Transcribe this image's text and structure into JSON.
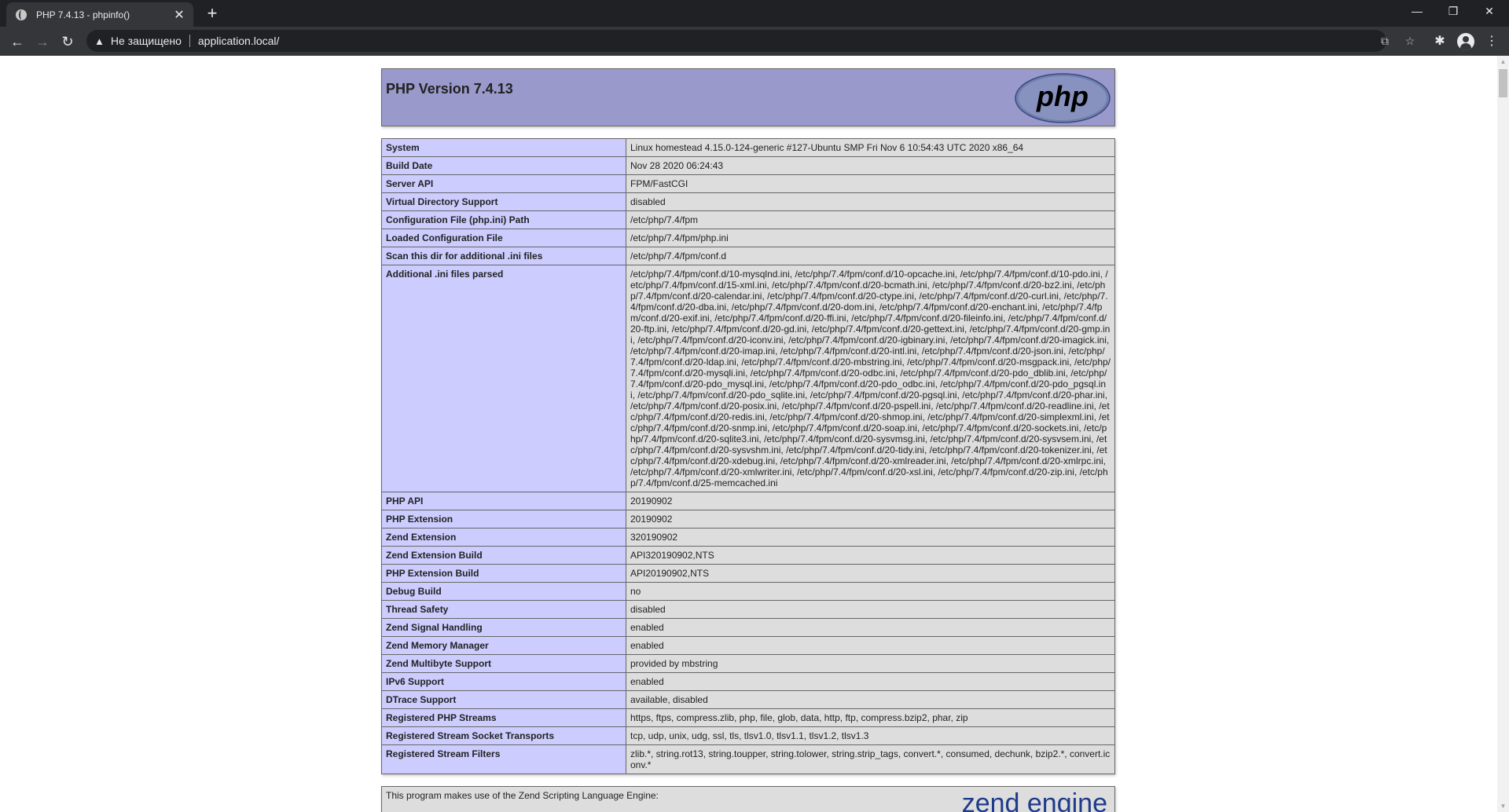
{
  "browser": {
    "tab_title": "PHP 7.4.13 - phpinfo()",
    "tab_close": "✕",
    "new_tab": "+",
    "security_label": "Не защищено",
    "url": "application.local/",
    "window_controls": {
      "minimize": "—",
      "restore": "❐",
      "close": "✕"
    }
  },
  "page": {
    "heading": "PHP Version 7.4.13",
    "logo_text": "php",
    "rows": [
      {
        "label": "System",
        "value": "Linux homestead 4.15.0-124-generic #127-Ubuntu SMP Fri Nov 6 10:54:43 UTC 2020 x86_64"
      },
      {
        "label": "Build Date",
        "value": "Nov 28 2020 06:24:43"
      },
      {
        "label": "Server API",
        "value": "FPM/FastCGI"
      },
      {
        "label": "Virtual Directory Support",
        "value": "disabled"
      },
      {
        "label": "Configuration File (php.ini) Path",
        "value": "/etc/php/7.4/fpm"
      },
      {
        "label": "Loaded Configuration File",
        "value": "/etc/php/7.4/fpm/php.ini"
      },
      {
        "label": "Scan this dir for additional .ini files",
        "value": "/etc/php/7.4/fpm/conf.d"
      },
      {
        "label": "Additional .ini files parsed",
        "value": "/etc/php/7.4/fpm/conf.d/10-mysqlnd.ini, /etc/php/7.4/fpm/conf.d/10-opcache.ini, /etc/php/7.4/fpm/conf.d/10-pdo.ini, /etc/php/7.4/fpm/conf.d/15-xml.ini, /etc/php/7.4/fpm/conf.d/20-bcmath.ini, /etc/php/7.4/fpm/conf.d/20-bz2.ini, /etc/php/7.4/fpm/conf.d/20-calendar.ini, /etc/php/7.4/fpm/conf.d/20-ctype.ini, /etc/php/7.4/fpm/conf.d/20-curl.ini, /etc/php/7.4/fpm/conf.d/20-dba.ini, /etc/php/7.4/fpm/conf.d/20-dom.ini, /etc/php/7.4/fpm/conf.d/20-enchant.ini, /etc/php/7.4/fpm/conf.d/20-exif.ini, /etc/php/7.4/fpm/conf.d/20-ffi.ini, /etc/php/7.4/fpm/conf.d/20-fileinfo.ini, /etc/php/7.4/fpm/conf.d/20-ftp.ini, /etc/php/7.4/fpm/conf.d/20-gd.ini, /etc/php/7.4/fpm/conf.d/20-gettext.ini, /etc/php/7.4/fpm/conf.d/20-gmp.ini, /etc/php/7.4/fpm/conf.d/20-iconv.ini, /etc/php/7.4/fpm/conf.d/20-igbinary.ini, /etc/php/7.4/fpm/conf.d/20-imagick.ini, /etc/php/7.4/fpm/conf.d/20-imap.ini, /etc/php/7.4/fpm/conf.d/20-intl.ini, /etc/php/7.4/fpm/conf.d/20-json.ini, /etc/php/7.4/fpm/conf.d/20-ldap.ini, /etc/php/7.4/fpm/conf.d/20-mbstring.ini, /etc/php/7.4/fpm/conf.d/20-msgpack.ini, /etc/php/7.4/fpm/conf.d/20-mysqli.ini, /etc/php/7.4/fpm/conf.d/20-odbc.ini, /etc/php/7.4/fpm/conf.d/20-pdo_dblib.ini, /etc/php/7.4/fpm/conf.d/20-pdo_mysql.ini, /etc/php/7.4/fpm/conf.d/20-pdo_odbc.ini, /etc/php/7.4/fpm/conf.d/20-pdo_pgsql.ini, /etc/php/7.4/fpm/conf.d/20-pdo_sqlite.ini, /etc/php/7.4/fpm/conf.d/20-pgsql.ini, /etc/php/7.4/fpm/conf.d/20-phar.ini, /etc/php/7.4/fpm/conf.d/20-posix.ini, /etc/php/7.4/fpm/conf.d/20-pspell.ini, /etc/php/7.4/fpm/conf.d/20-readline.ini, /etc/php/7.4/fpm/conf.d/20-redis.ini, /etc/php/7.4/fpm/conf.d/20-shmop.ini, /etc/php/7.4/fpm/conf.d/20-simplexml.ini, /etc/php/7.4/fpm/conf.d/20-snmp.ini, /etc/php/7.4/fpm/conf.d/20-soap.ini, /etc/php/7.4/fpm/conf.d/20-sockets.ini, /etc/php/7.4/fpm/conf.d/20-sqlite3.ini, /etc/php/7.4/fpm/conf.d/20-sysvmsg.ini, /etc/php/7.4/fpm/conf.d/20-sysvsem.ini, /etc/php/7.4/fpm/conf.d/20-sysvshm.ini, /etc/php/7.4/fpm/conf.d/20-tidy.ini, /etc/php/7.4/fpm/conf.d/20-tokenizer.ini, /etc/php/7.4/fpm/conf.d/20-xdebug.ini, /etc/php/7.4/fpm/conf.d/20-xmlreader.ini, /etc/php/7.4/fpm/conf.d/20-xmlrpc.ini, /etc/php/7.4/fpm/conf.d/20-xmlwriter.ini, /etc/php/7.4/fpm/conf.d/20-xsl.ini, /etc/php/7.4/fpm/conf.d/20-zip.ini, /etc/php/7.4/fpm/conf.d/25-memcached.ini"
      },
      {
        "label": "PHP API",
        "value": "20190902"
      },
      {
        "label": "PHP Extension",
        "value": "20190902"
      },
      {
        "label": "Zend Extension",
        "value": "320190902"
      },
      {
        "label": "Zend Extension Build",
        "value": "API320190902,NTS"
      },
      {
        "label": "PHP Extension Build",
        "value": "API20190902,NTS"
      },
      {
        "label": "Debug Build",
        "value": "no"
      },
      {
        "label": "Thread Safety",
        "value": "disabled"
      },
      {
        "label": "Zend Signal Handling",
        "value": "enabled"
      },
      {
        "label": "Zend Memory Manager",
        "value": "enabled"
      },
      {
        "label": "Zend Multibyte Support",
        "value": "provided by mbstring"
      },
      {
        "label": "IPv6 Support",
        "value": "enabled"
      },
      {
        "label": "DTrace Support",
        "value": "available, disabled"
      },
      {
        "label": "Registered PHP Streams",
        "value": "https, ftps, compress.zlib, php, file, glob, data, http, ftp, compress.bzip2, phar, zip"
      },
      {
        "label": "Registered Stream Socket Transports",
        "value": "tcp, udp, unix, udg, ssl, tls, tlsv1.0, tlsv1.1, tlsv1.2, tlsv1.3"
      },
      {
        "label": "Registered Stream Filters",
        "value": "zlib.*, string.rot13, string.toupper, string.tolower, string.strip_tags, convert.*, consumed, dechunk, bzip2.*, convert.iconv.*"
      }
    ],
    "engine_text": "This program makes use of the Zend Scripting Language Engine:",
    "engine_logo_text": "zend engine"
  },
  "colors": {
    "header_bg": "#9999cc",
    "label_bg": "#ccccff",
    "value_bg": "#dddddd",
    "chrome_dark": "#202124",
    "chrome_tab": "#35363a"
  }
}
